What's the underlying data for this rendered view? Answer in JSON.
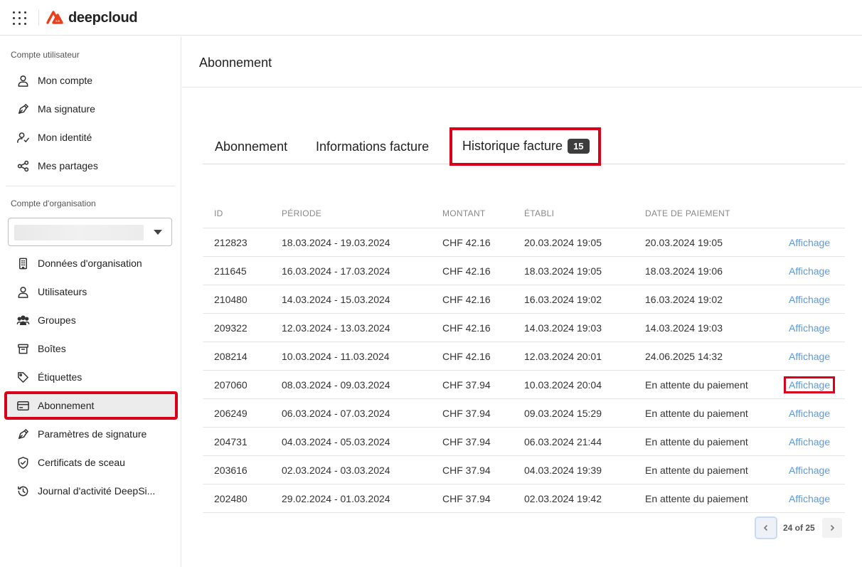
{
  "app": {
    "brand": "deepcloud",
    "brand_color": "#e8401c"
  },
  "sidebar": {
    "user_section_title": "Compte utilisateur",
    "user_items": [
      {
        "label": "Mon compte",
        "icon": "user-icon"
      },
      {
        "label": "Ma signature",
        "icon": "pen-icon"
      },
      {
        "label": "Mon identité",
        "icon": "user-check-icon"
      },
      {
        "label": "Mes partages",
        "icon": "share-icon"
      }
    ],
    "org_section_title": "Compte d'organisation",
    "org_select_value": "",
    "org_items": [
      {
        "label": "Données d'organisation",
        "icon": "building-icon"
      },
      {
        "label": "Utilisateurs",
        "icon": "user-icon"
      },
      {
        "label": "Groupes",
        "icon": "group-icon"
      },
      {
        "label": "Boîtes",
        "icon": "archive-box-icon"
      },
      {
        "label": "Étiquettes",
        "icon": "tag-icon"
      },
      {
        "label": "Abonnement",
        "icon": "credit-card-icon",
        "active": true
      },
      {
        "label": "Paramètres de signature",
        "icon": "pen-icon"
      },
      {
        "label": "Certificats de sceau",
        "icon": "shield-check-icon"
      },
      {
        "label": "Journal d'activité DeepSi...",
        "icon": "history-icon"
      }
    ]
  },
  "main": {
    "title": "Abonnement",
    "tabs": [
      {
        "label": "Abonnement"
      },
      {
        "label": "Informations facture"
      },
      {
        "label": "Historique facture",
        "badge": "15",
        "active": true
      }
    ],
    "table": {
      "headers": [
        "ID",
        "PÉRIODE",
        "MONTANT",
        "ÉTABLI",
        "DATE DE PAIEMENT",
        ""
      ],
      "rows": [
        {
          "id": "212823",
          "period": "18.03.2024 - 19.03.2024",
          "amount": "CHF 42.16",
          "issued": "20.03.2024 19:05",
          "paid": "20.03.2024 19:05",
          "action": "Affichage"
        },
        {
          "id": "211645",
          "period": "16.03.2024 - 17.03.2024",
          "amount": "CHF 42.16",
          "issued": "18.03.2024 19:05",
          "paid": "18.03.2024 19:06",
          "action": "Affichage"
        },
        {
          "id": "210480",
          "period": "14.03.2024 - 15.03.2024",
          "amount": "CHF 42.16",
          "issued": "16.03.2024 19:02",
          "paid": "16.03.2024 19:02",
          "action": "Affichage"
        },
        {
          "id": "209322",
          "period": "12.03.2024 - 13.03.2024",
          "amount": "CHF 42.16",
          "issued": "14.03.2024 19:03",
          "paid": "14.03.2024 19:03",
          "action": "Affichage"
        },
        {
          "id": "208214",
          "period": "10.03.2024 - 11.03.2024",
          "amount": "CHF 42.16",
          "issued": "12.03.2024 20:01",
          "paid": "24.06.2025 14:32",
          "action": "Affichage"
        },
        {
          "id": "207060",
          "period": "08.03.2024 - 09.03.2024",
          "amount": "CHF 37.94",
          "issued": "10.03.2024 20:04",
          "paid": "En attente du paiement",
          "action": "Affichage",
          "highlight": true
        },
        {
          "id": "206249",
          "period": "06.03.2024 - 07.03.2024",
          "amount": "CHF 37.94",
          "issued": "09.03.2024 15:29",
          "paid": "En attente du paiement",
          "action": "Affichage"
        },
        {
          "id": "204731",
          "period": "04.03.2024 - 05.03.2024",
          "amount": "CHF 37.94",
          "issued": "06.03.2024 21:44",
          "paid": "En attente du paiement",
          "action": "Affichage"
        },
        {
          "id": "203616",
          "period": "02.03.2024 - 03.03.2024",
          "amount": "CHF 37.94",
          "issued": "04.03.2024 19:39",
          "paid": "En attente du paiement",
          "action": "Affichage"
        },
        {
          "id": "202480",
          "period": "29.02.2024 - 01.03.2024",
          "amount": "CHF 37.94",
          "issued": "02.03.2024 19:42",
          "paid": "En attente du paiement",
          "action": "Affichage"
        }
      ]
    },
    "pagination": {
      "label": "24 of 25"
    }
  },
  "colors": {
    "link": "#5a9ae0",
    "highlight_border": "#d9001b",
    "badge_bg": "#3d3d3d"
  }
}
